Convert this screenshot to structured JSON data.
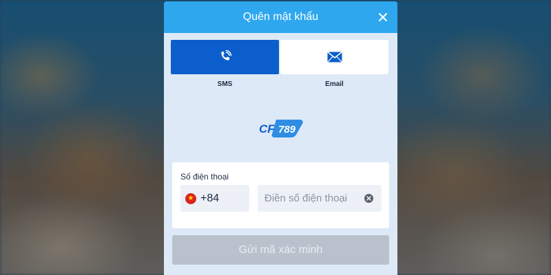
{
  "dialog": {
    "title": "Quên mật khẩu",
    "close_icon": "close-icon"
  },
  "methods": [
    {
      "label": "SMS",
      "icon": "phone-icon",
      "selected": true
    },
    {
      "label": "Email",
      "icon": "envelope-icon",
      "selected": false
    }
  ],
  "logo": {
    "text_cf": "CF",
    "text_num": "789"
  },
  "phone": {
    "label": "Số điện thoại",
    "country_flag": "vietnam-flag-icon",
    "dial_code": "+84",
    "placeholder": "Điền số điện thoại",
    "value": ""
  },
  "submit": {
    "label": "Gửi mã xác minh",
    "disabled": true
  },
  "colors": {
    "header": "#2ea7ef",
    "selected_method": "#0b5ecb",
    "panel": "#dde9f7",
    "disabled_button": "#b9c2cc"
  }
}
